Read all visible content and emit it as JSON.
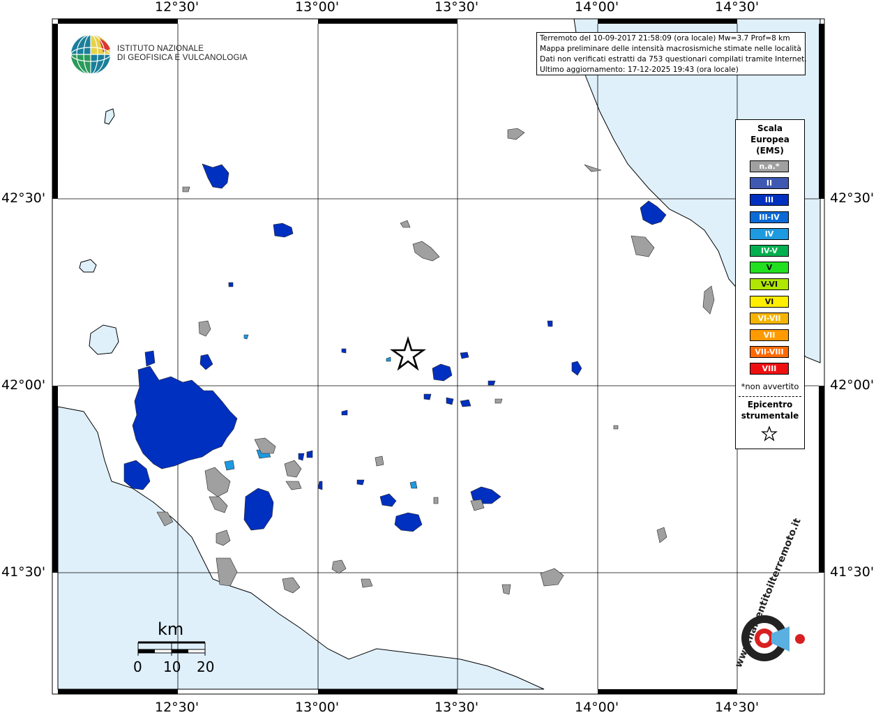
{
  "axes": {
    "lon_labels": [
      "12°30'",
      "13°00'",
      "13°30'",
      "14°00'",
      "14°30'"
    ],
    "lat_labels": [
      "42°30'",
      "42°00'",
      "41°30'"
    ]
  },
  "logo": {
    "line1": "ISTITUTO NAZIONALE",
    "line2": "DI GEOFISICA E VULCANOLOGIA"
  },
  "info": {
    "line1": "Terremoto del 10-09-2017 21:58:09 (ora locale) Mw=3.7 Prof=8 km",
    "line2": "Mappa preliminare delle intensità macrosismiche stimate nelle località",
    "line3": "Dati non verificati estratti da 753 questionari compilati tramite Internet.",
    "line4": "Ultimo aggiornamento: 17-12-2025 19:43 (ora locale)"
  },
  "legend": {
    "title1": "Scala",
    "title2": "Europea",
    "title3": "(EMS)",
    "items": [
      {
        "label": "n.a.*",
        "color": "#a0a0a0"
      },
      {
        "label": "II",
        "color": "#3f59b3"
      },
      {
        "label": "III",
        "color": "#0030c0"
      },
      {
        "label": "III-IV",
        "color": "#0a6ad6"
      },
      {
        "label": "IV",
        "color": "#1e9ae0"
      },
      {
        "label": "IV-V",
        "color": "#00b050"
      },
      {
        "label": "V",
        "color": "#22e020"
      },
      {
        "label": "V-VI",
        "color": "#b0e600"
      },
      {
        "label": "VI",
        "color": "#ffee00"
      },
      {
        "label": "VI-VII",
        "color": "#f5b400"
      },
      {
        "label": "VII",
        "color": "#ff9a00"
      },
      {
        "label": "VII-VIII",
        "color": "#ff6a00"
      },
      {
        "label": "VIII",
        "color": "#ee1010"
      }
    ],
    "note": "*non avvertito",
    "epicenter1": "Epicentro",
    "epicenter2": "strumentale"
  },
  "scale_bar": {
    "unit": "km",
    "ticks": [
      "0",
      "10",
      "20"
    ]
  },
  "brand": {
    "url": "www.haisentitoilterremoto.it"
  },
  "colors": {
    "sea": "#dff0fb",
    "land": "#ffffff",
    "na": "#a0a0a0",
    "III": "#0030c0",
    "IV": "#1e9ae0"
  }
}
